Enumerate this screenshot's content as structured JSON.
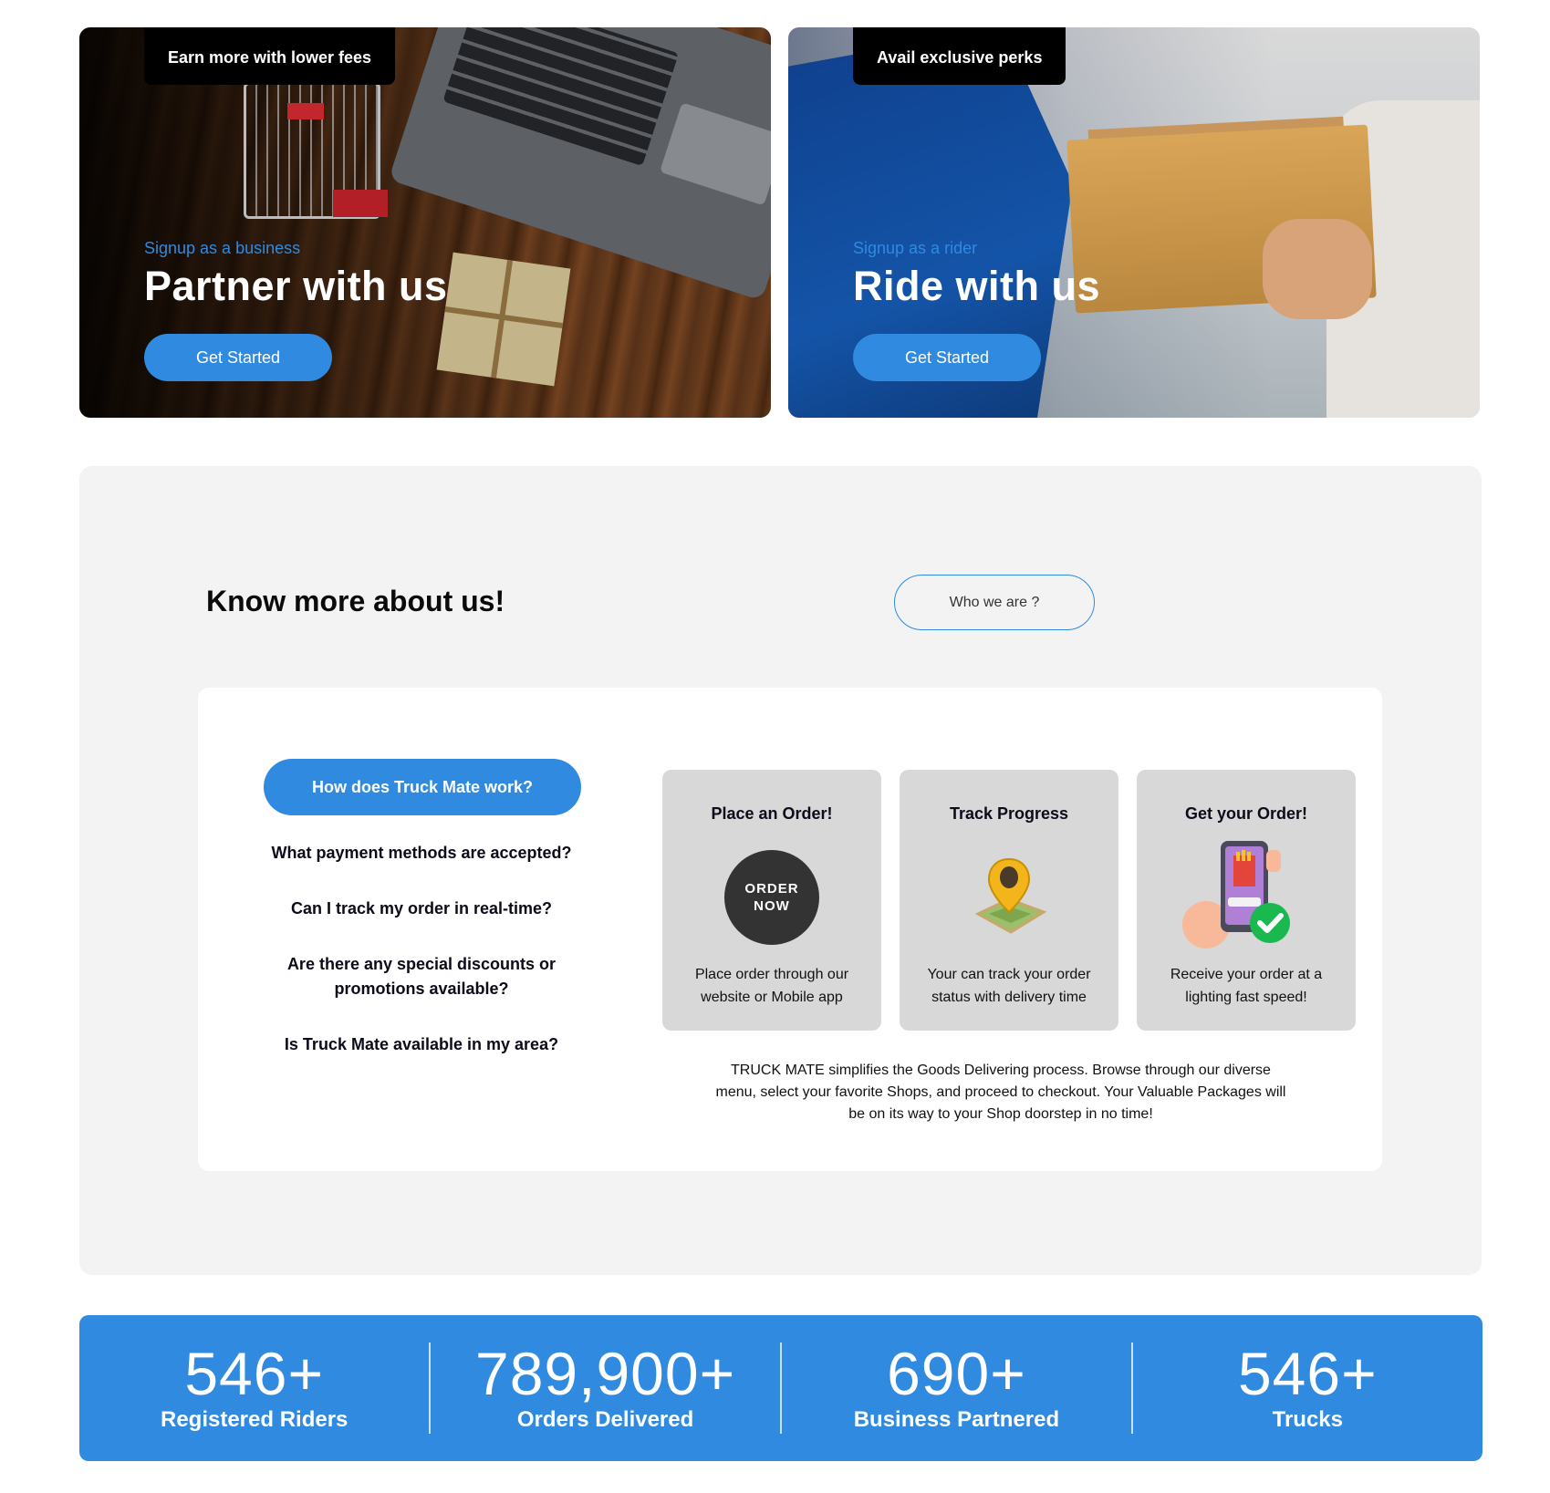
{
  "hero_cards": [
    {
      "tab": "Earn more with lower fees",
      "kicker": "Signup as a business",
      "title": "Partner with us",
      "cta": "Get Started"
    },
    {
      "tab": "Avail exclusive perks",
      "kicker": "Signup as a rider",
      "title": "Ride with us",
      "cta": "Get Started"
    }
  ],
  "about": {
    "heading": "Know more about us!",
    "who_button": "Who we are ?",
    "faq_active": "How does Truck Mate work?",
    "faq": [
      "What payment methods are accepted?",
      "Can I track my order in real-time?",
      "Are there any special discounts or promotions available?",
      "Is Truck Mate available in my area?"
    ],
    "steps": [
      {
        "title": "Place an Order!",
        "icon": "order-now-badge-icon",
        "icon_text_1": "ORDER",
        "icon_text_2": "NOW",
        "desc": "Place order through our website or Mobile app"
      },
      {
        "title": "Track Progress",
        "icon": "map-pin-icon",
        "desc": "Your can track your order status with delivery time"
      },
      {
        "title": "Get your Order!",
        "icon": "phone-checkmark-icon",
        "desc": "Receive your order at a lighting fast speed!"
      }
    ],
    "description": "TRUCK MATE simplifies the Goods Delivering process. Browse through our diverse menu, select your favorite Shops, and proceed to checkout. Your Valuable Packages will be on its way to your Shop doorstep in no time!"
  },
  "stats": [
    {
      "number": "546+",
      "label": "Registered Riders"
    },
    {
      "number": "789,900+",
      "label": "Orders Delivered"
    },
    {
      "number": "690+",
      "label": "Business Partnered"
    },
    {
      "number": "546+",
      "label": "Trucks"
    }
  ],
  "colors": {
    "accent": "#2f8ae0",
    "section_bg": "#f3f3f3",
    "card_bg": "#d8d8d8"
  }
}
